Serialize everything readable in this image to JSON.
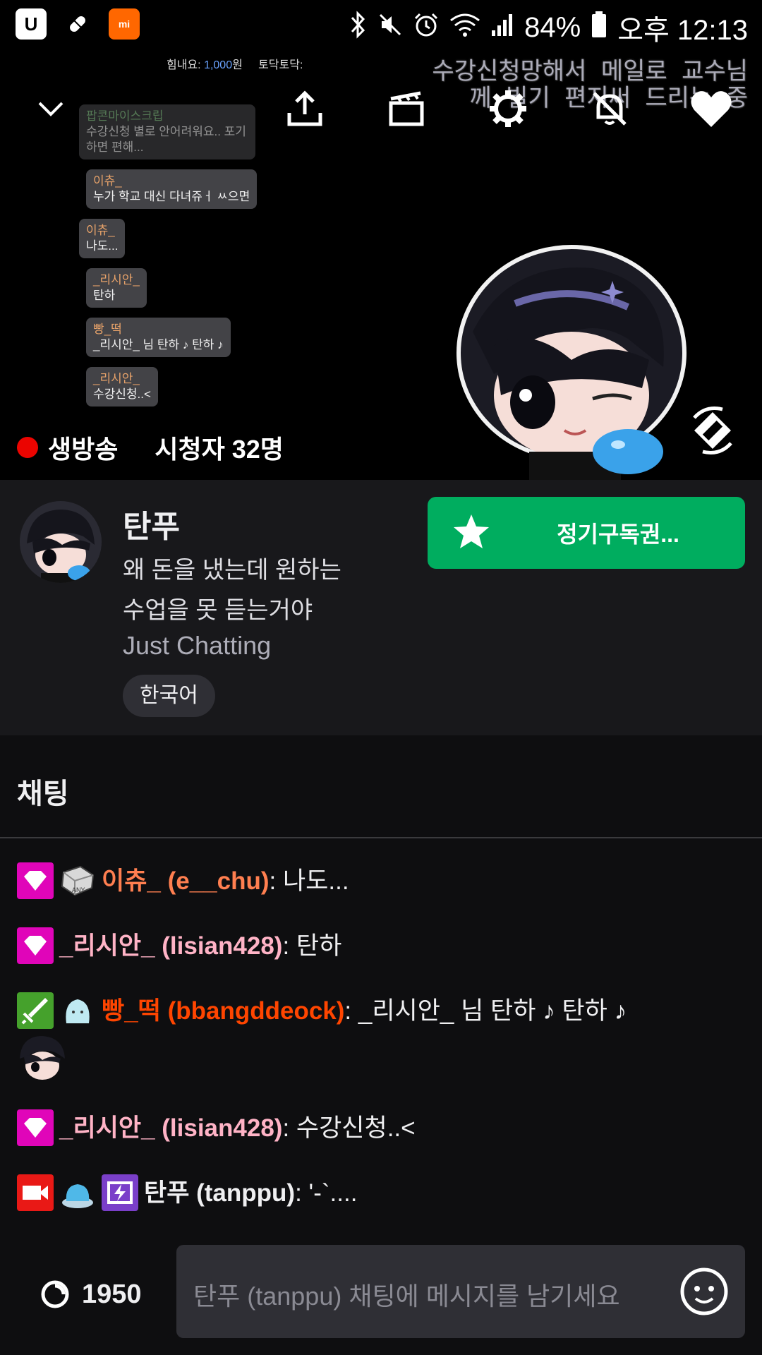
{
  "status_bar": {
    "battery": "84%",
    "time": "오후 12:13",
    "left_icons": [
      "u-plus-icon",
      "pill-icon",
      "mi-icon"
    ],
    "right_icons": [
      "bluetooth-icon",
      "mute-icon",
      "alarm-icon",
      "wifi-icon",
      "signal-icon",
      "battery-icon"
    ]
  },
  "video": {
    "donation_label": "힘내요:",
    "donation_amount": "1,000",
    "donation_unit": "원",
    "donation_label2": "토닥토닥:",
    "overlay_line1": "수강신청망해서 메일로 교수님",
    "overlay_line2": "께 빌기 편지써 드리는 중",
    "bubbles": [
      {
        "name": "팝콘마이스크립",
        "text": "수강신청 별로 안어려워요.. 포기하면 편해..."
      },
      {
        "name": "이츄_",
        "text": "누가 학교 대신 다녀쥬ㅓ ㅆ으면"
      },
      {
        "name": "이츄_",
        "text": "나도..."
      },
      {
        "name": "_리시안_",
        "text": "탄하"
      },
      {
        "name": "빵_떡",
        "text": "_리시안_ 님 탄하 ♪ 탄하 ♪"
      },
      {
        "name": "_리시안_",
        "text": "수강신청..<"
      }
    ],
    "live_label": "생방송",
    "viewers_label": "시청자 32명"
  },
  "channel": {
    "name": "탄푸",
    "title_line1": "왜 돈을 냈는데 원하는",
    "title_line2": "수업을 못 듣는거야",
    "category": "Just Chatting",
    "language": "한국어",
    "subscribe_label": "정기구독권..."
  },
  "chat": {
    "heading": "채팅",
    "messages": [
      {
        "user": "이츄_ (e__chu)",
        "text": ": 나도...",
        "color": "#ff7f50"
      },
      {
        "user": "_리시안_ (lisian428)",
        "text": ": 탄하",
        "color": "#ffb3c6"
      },
      {
        "user": "빵_떡 (bbangddeock)",
        "text": ": _리시안_ 님 탄하 ♪ 탄하 ♪",
        "color": "#ff4500"
      },
      {
        "user": "_리시안_ (lisian428)",
        "text": ": 수강신청..<",
        "color": "#ffb3c6"
      },
      {
        "user": "탄푸 (tanppu)",
        "text": ": '-`....",
        "color": "#efeff1"
      }
    ],
    "input_placeholder": "탄푸 (tanppu) 채팅에 메시지를 남기세요",
    "points": "1950"
  }
}
